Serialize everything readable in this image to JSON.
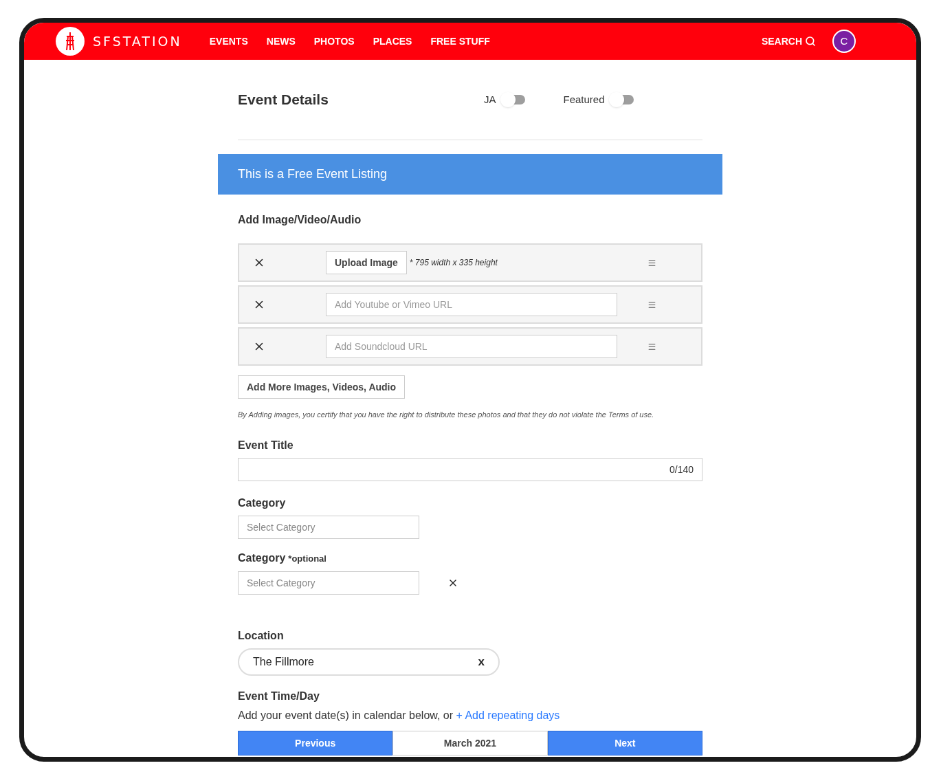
{
  "nav": {
    "logo_text": "SFSTATION",
    "items": [
      "EVENTS",
      "NEWS",
      "PHOTOS",
      "PLACES",
      "FREE STUFF"
    ],
    "search": "SEARCH",
    "avatar_initial": "C"
  },
  "header": {
    "title": "Event Details",
    "toggles": [
      {
        "label": "JA",
        "on": false
      },
      {
        "label": "Featured",
        "on": false
      }
    ]
  },
  "banner": "This is a Free Event Listing",
  "media": {
    "heading": "Add Image/Video/Audio",
    "rows": [
      {
        "kind": "image",
        "button": "Upload Image",
        "hint": "* 795 width x 335 height"
      },
      {
        "kind": "url",
        "placeholder": "Add Youtube or Vimeo URL"
      },
      {
        "kind": "url",
        "placeholder": "Add Soundcloud URL"
      }
    ],
    "add_more": "Add More Images, Videos, Audio",
    "disclaimer": "By Adding images, you certify that you have the right to distribute these photos and that they do not violate the Terms of use."
  },
  "event_title": {
    "label": "Event Title",
    "counter": "0/140"
  },
  "category": {
    "label": "Category",
    "placeholder": "Select Category"
  },
  "category_optional": {
    "label": "Category",
    "note": "*optional",
    "placeholder": "Select Category"
  },
  "location": {
    "label": "Location",
    "value": "The Fillmore",
    "clear": "x"
  },
  "time": {
    "label": "Event Time/Day",
    "text": "Add your event date(s) in calendar below, or",
    "link": "+ Add repeating days"
  },
  "calendar": {
    "previous": "Previous",
    "month": "March 2021",
    "next": "Next"
  }
}
